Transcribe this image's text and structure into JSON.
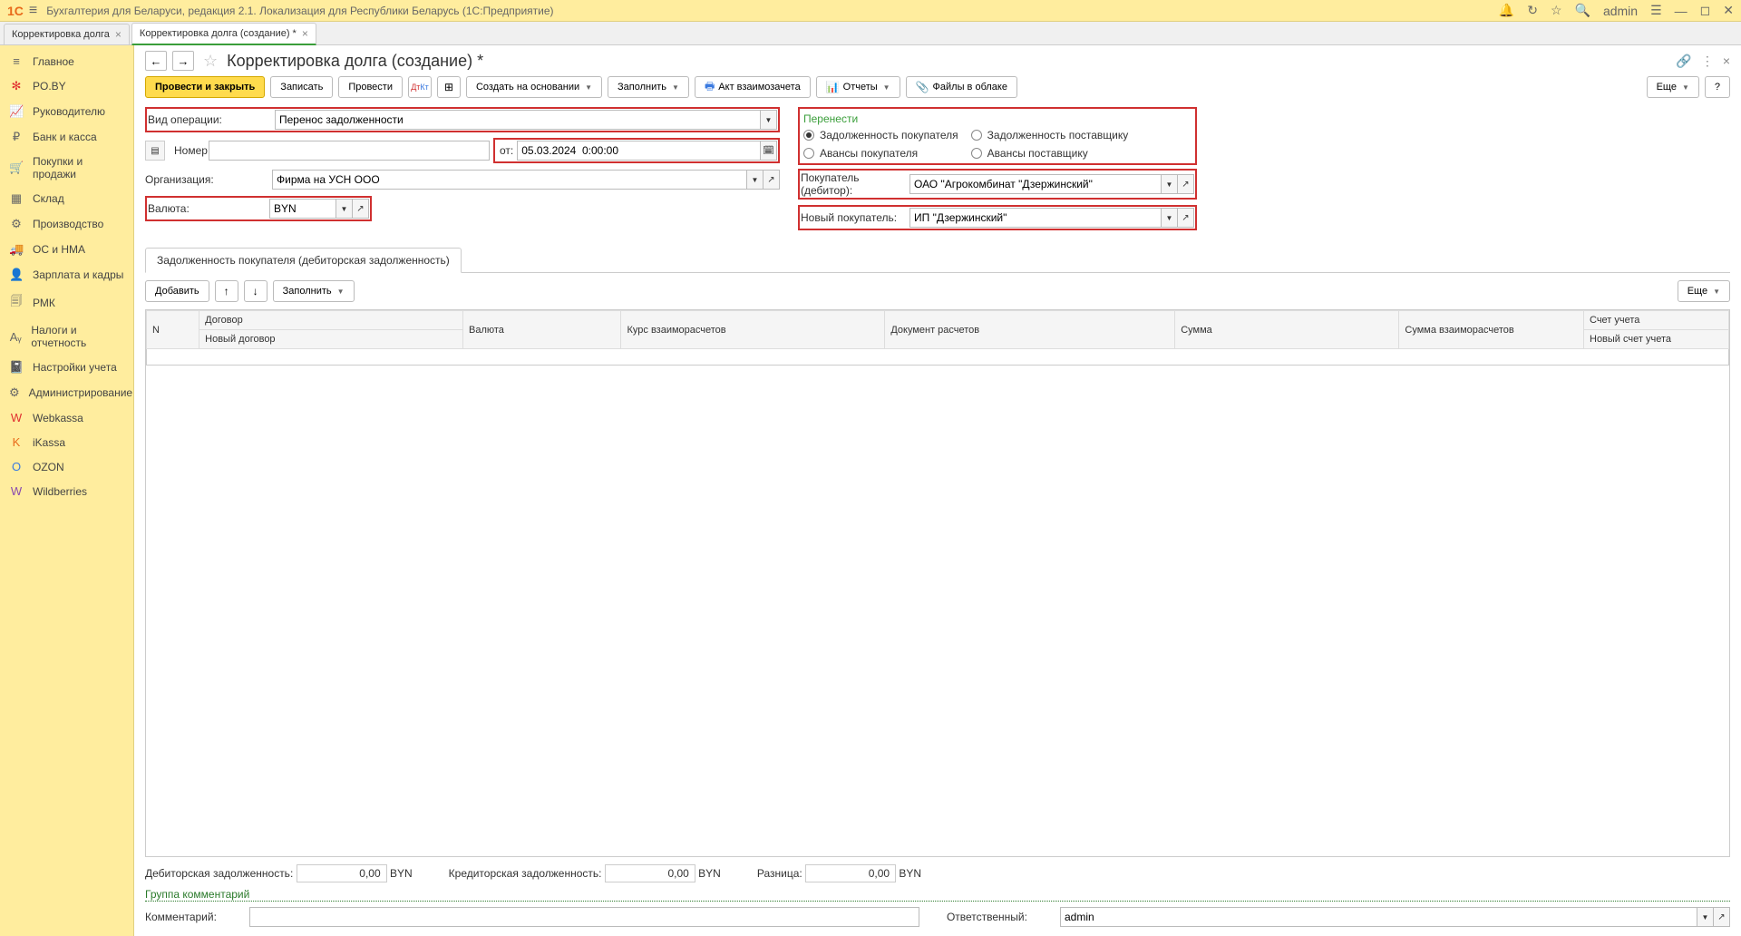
{
  "titlebar": {
    "logo": "1C",
    "app_title": "Бухгалтерия для Беларуси, редакция 2.1. Локализация для Республики Беларусь  (1С:Предприятие)",
    "user": "admin"
  },
  "tabs": [
    {
      "label": "Корректировка долга",
      "active": false
    },
    {
      "label": "Корректировка долга (создание) *",
      "active": true
    }
  ],
  "sidebar": [
    {
      "label": "Главное",
      "icon": "≡"
    },
    {
      "label": "PO.BY",
      "icon": "✻"
    },
    {
      "label": "Руководителю",
      "icon": "📈"
    },
    {
      "label": "Банк и касса",
      "icon": "₽"
    },
    {
      "label": "Покупки и продажи",
      "icon": "🛒"
    },
    {
      "label": "Склад",
      "icon": "▦"
    },
    {
      "label": "Производство",
      "icon": "⚙"
    },
    {
      "label": "ОС и НМА",
      "icon": "🚚"
    },
    {
      "label": "Зарплата и кадры",
      "icon": "👤"
    },
    {
      "label": "РМК",
      "icon": "🗐"
    },
    {
      "label": "Налоги и отчетность",
      "icon": "Aᵧ"
    },
    {
      "label": "Настройки учета",
      "icon": "📓"
    },
    {
      "label": "Администрирование",
      "icon": "⚙"
    },
    {
      "label": "Webkassa",
      "icon": "W"
    },
    {
      "label": "iKassa",
      "icon": "K"
    },
    {
      "label": "OZON",
      "icon": "O"
    },
    {
      "label": "Wildberries",
      "icon": "W"
    }
  ],
  "form": {
    "title": "Корректировка долга (создание) *",
    "toolbar": {
      "post_close": "Провести и закрыть",
      "save": "Записать",
      "post": "Провести",
      "create_based": "Создать на основании",
      "fill": "Заполнить",
      "act": "Акт взаимозачета",
      "reports": "Отчеты",
      "files": "Файлы в облаке",
      "more": "Еще",
      "help": "?"
    },
    "fields": {
      "op_type_label": "Вид операции:",
      "op_type": "Перенос задолженности",
      "number_label": "Номер:",
      "number": "",
      "date_label": "от:",
      "date": "05.03.2024  0:00:00",
      "org_label": "Организация:",
      "org": "Фирма на УСН ООО",
      "currency_label": "Валюта:",
      "currency": "BYN"
    },
    "transfer": {
      "header": "Перенести",
      "opt1": "Задолженность покупателя",
      "opt2": "Авансы покупателя",
      "opt3": "Задолженность поставщику",
      "opt4": "Авансы поставщику",
      "buyer_label": "Покупатель (дебитор):",
      "buyer": "ОАО \"Агрокомбинат \"Дзержинский\"",
      "newbuyer_label": "Новый покупатель:",
      "newbuyer": "ИП \"Дзержинский\""
    },
    "subtab": "Задолженность покупателя (дебиторская задолженность)",
    "tabletools": {
      "add": "Добавить",
      "fill": "Заполнить",
      "more": "Еще"
    },
    "columns": {
      "n": "N",
      "contract": "Договор",
      "currency": "Валюта",
      "rate": "Курс взаиморасчетов",
      "doc": "Документ расчетов",
      "sum": "Сумма",
      "sum_mutual": "Сумма взаиморасчетов",
      "account": "Счет учета",
      "sub_contract": "Новый договор",
      "sub_account": "Новый счет учета"
    },
    "totals": {
      "debit_label": "Дебиторская задолженность:",
      "debit_val": "0,00",
      "debit_cur": "BYN",
      "credit_label": "Кредиторская задолженность:",
      "credit_val": "0,00",
      "credit_cur": "BYN",
      "diff_label": "Разница:",
      "diff_val": "0,00",
      "diff_cur": "BYN"
    },
    "comments_group": "Группа комментарий",
    "comment_label": "Комментарий:",
    "comment": "",
    "resp_label": "Ответственный:",
    "resp": "admin"
  }
}
